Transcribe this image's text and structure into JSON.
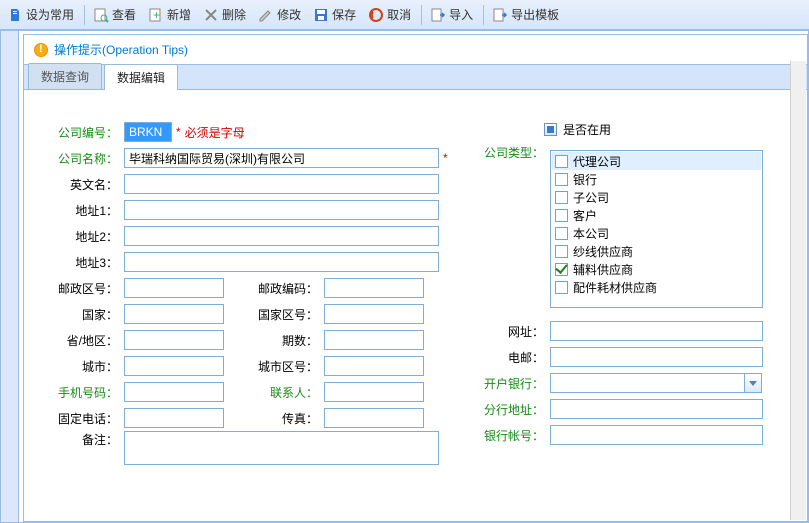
{
  "toolbar": {
    "set_common": "设为常用",
    "view": "查看",
    "new": "新增",
    "delete": "删除",
    "edit": "修改",
    "save": "保存",
    "cancel": "取消",
    "import": "导入",
    "export_tpl": "导出模板"
  },
  "tips": {
    "text": "操作提示(Operation Tips)"
  },
  "tabs": {
    "query": "数据查询",
    "edit": "数据编辑"
  },
  "left": {
    "code_lbl": "公司编号：",
    "code_val": "BRKN",
    "code_hint": "必须是字母",
    "name_lbl": "公司名称：",
    "name_val": "毕瑞科纳国际贸易(深圳)有限公司",
    "en_lbl": "英文名：",
    "addr1_lbl": "地址1：",
    "addr2_lbl": "地址2：",
    "addr3_lbl": "地址3：",
    "postarea_lbl": "邮政区号：",
    "postcode_lbl": "邮政编码：",
    "country_lbl": "国家：",
    "countryarea_lbl": "国家区号：",
    "province_lbl": "省/地区：",
    "periods_lbl": "期数：",
    "city_lbl": "城市：",
    "cityarea_lbl": "城市区号：",
    "mobile_lbl": "手机号码：",
    "contact_lbl": "联系人：",
    "tel_lbl": "固定电话：",
    "fax_lbl": "传真：",
    "remark_lbl": "备注："
  },
  "right": {
    "inuse_lbl": "是否在用",
    "type_lbl": "公司类型：",
    "types": [
      {
        "label": "代理公司",
        "checked": false
      },
      {
        "label": "银行",
        "checked": false
      },
      {
        "label": "子公司",
        "checked": false
      },
      {
        "label": "客户",
        "checked": false
      },
      {
        "label": "本公司",
        "checked": false
      },
      {
        "label": "纱线供应商",
        "checked": false
      },
      {
        "label": "辅料供应商",
        "checked": true
      },
      {
        "label": "配件耗材供应商",
        "checked": false
      }
    ],
    "url_lbl": "网址：",
    "email_lbl": "电邮：",
    "bank_lbl": "开户银行：",
    "branch_lbl": "分行地址：",
    "account_lbl": "银行帐号："
  }
}
